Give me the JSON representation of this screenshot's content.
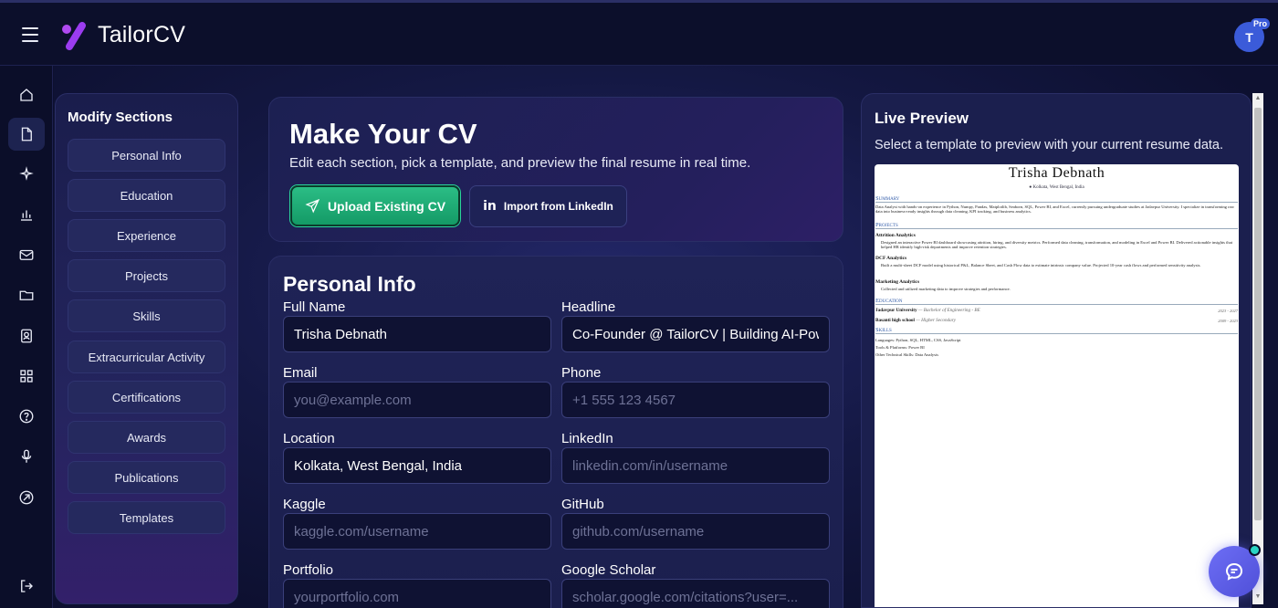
{
  "app": {
    "brand": "TailorCV",
    "avatar_initial": "T",
    "badge": "Pro"
  },
  "sidebar": {
    "icons": [
      "home-icon",
      "document-icon",
      "sparkle-icon",
      "chart-icon",
      "mail-icon",
      "folder-icon",
      "contact-icon",
      "grid-icon",
      "help-icon",
      "microphone-icon",
      "target-icon",
      "logout-icon"
    ],
    "active_index": 1
  },
  "modify": {
    "title": "Modify Sections",
    "items": [
      "Personal Info",
      "Education",
      "Experience",
      "Projects",
      "Skills",
      "Extracurricular Activity",
      "Certifications",
      "Awards",
      "Publications",
      "Templates"
    ]
  },
  "hero": {
    "title": "Make Your CV",
    "subtitle": "Edit each section, pick a template, and preview the final resume in real time.",
    "upload_label": "Upload Existing CV",
    "linkedin_icon": "in",
    "linkedin_label": "Import from LinkedIn"
  },
  "form": {
    "title": "Personal Info",
    "fields": {
      "full_name": {
        "label": "Full Name",
        "value": "Trisha Debnath",
        "placeholder": ""
      },
      "headline": {
        "label": "Headline",
        "value": "Co-Founder @ TailorCV | Building AI-Powered",
        "placeholder": ""
      },
      "email": {
        "label": "Email",
        "value": "",
        "placeholder": "you@example.com"
      },
      "phone": {
        "label": "Phone",
        "value": "",
        "placeholder": "+1 555 123 4567"
      },
      "location": {
        "label": "Location",
        "value": "Kolkata, West Bengal, India",
        "placeholder": ""
      },
      "linkedin": {
        "label": "LinkedIn",
        "value": "",
        "placeholder": "linkedin.com/in/username"
      },
      "kaggle": {
        "label": "Kaggle",
        "value": "",
        "placeholder": "kaggle.com/username"
      },
      "github": {
        "label": "GitHub",
        "value": "",
        "placeholder": "github.com/username"
      },
      "portfolio": {
        "label": "Portfolio",
        "value": "",
        "placeholder": "yourportfolio.com"
      },
      "scholar": {
        "label": "Google Scholar",
        "value": "",
        "placeholder": "scholar.google.com/citations?user=..."
      }
    }
  },
  "preview": {
    "title": "Live Preview",
    "subtitle": "Select a template to preview with your current resume data.",
    "resume": {
      "name": "Trisha Debnath",
      "location": "Kolkata, West Bengal, India",
      "summary_heading": "Summary",
      "summary": "Data Analyst with hands-on experience in Python, Numpy, Pandas, Matplotlib, Seaborn, SQL, Power BI, and Excel, currently pursuing undergraduate studies at Jadavpur University. I specialize in transforming raw data into business-ready insights through data cleaning, KPI tracking, and business analytics.",
      "projects_heading": "Projects",
      "project1_title": "Attrition Analytics",
      "project1_desc": "Designed an interactive Power BI dashboard showcasing attrition, hiring, and diversity metrics. Performed data cleaning, transformation, and modeling in Excel and Power BI. Delivered actionable insights that helped HR identify high-risk departments and improve retention strategies.",
      "project2_title": "DCF Analytics",
      "project2_desc": "Built a multi-sheet DCF model using historical P&L, Balance Sheet, and Cash Flow data to estimate intrinsic company value. Projected 10-year cash flows and performed sensitivity analysis.",
      "project3_title": "Marketing Analytics",
      "project3_desc": "Collected and utilized marketing data to improve strategies and performance.",
      "education_heading": "Education",
      "edu1_school": "Jadavpur University",
      "edu1_degree": "— Bachelor of Engineering - BE",
      "edu1_years": "2023 - 2027",
      "edu2_school": "Basanti high school",
      "edu2_degree": "— Higher Secondary",
      "edu2_years": "2009 - 2023",
      "skills_heading": "Skills",
      "skills_languages": "Languages: Python, SQL, HTML, CSS, JavaScript",
      "skills_tools": "Tools & Platforms: Power BI",
      "skills_other": "Other Technical Skills: Data Analysis"
    }
  }
}
